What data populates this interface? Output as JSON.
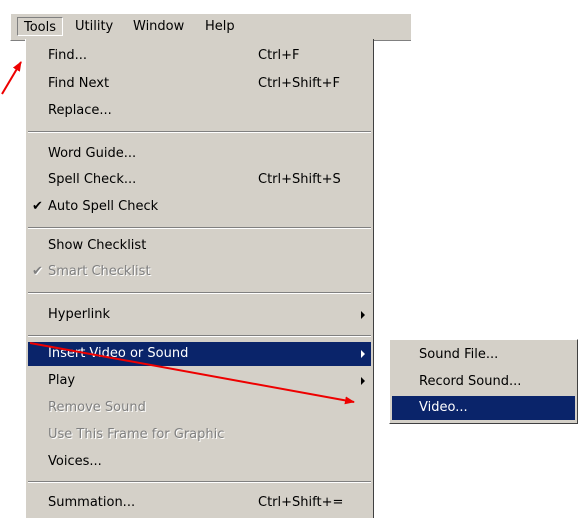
{
  "menubar": {
    "items": [
      {
        "label": "Tools",
        "open": true
      },
      {
        "label": "Utility"
      },
      {
        "label": "Window"
      },
      {
        "label": "Help"
      }
    ]
  },
  "tools_menu": {
    "items": [
      {
        "label": "Find...",
        "shortcut": "Ctrl+F"
      },
      {
        "label": "Find Next",
        "shortcut": "Ctrl+Shift+F"
      },
      {
        "label": "Replace..."
      },
      {
        "label": "Word Guide..."
      },
      {
        "label": "Spell Check...",
        "shortcut": "Ctrl+Shift+S"
      },
      {
        "label": "Auto Spell Check",
        "checked": true,
        "check_glyph": "✔"
      },
      {
        "label": "Show Checklist"
      },
      {
        "label": "Smart Checklist",
        "checked": true,
        "disabled": true,
        "check_glyph": "✔"
      },
      {
        "label": "Hyperlink",
        "submenu": true
      },
      {
        "label": "Insert Video or Sound",
        "submenu": true,
        "highlighted": true
      },
      {
        "label": "Play",
        "submenu": true
      },
      {
        "label": "Remove Sound",
        "disabled": true
      },
      {
        "label": "Use This Frame for Graphic",
        "disabled": true
      },
      {
        "label": "Voices..."
      },
      {
        "label": "Summation...",
        "shortcut": "Ctrl+Shift+="
      }
    ]
  },
  "insert_submenu": {
    "items": [
      {
        "label": "Sound File..."
      },
      {
        "label": "Record Sound..."
      },
      {
        "label": "Video...",
        "highlighted": true
      }
    ]
  },
  "colors": {
    "menu_bg": "#d4d0c8",
    "highlight": "#0a246a",
    "annotation_arrow": "#ee0000",
    "disabled_text": "#808080"
  }
}
